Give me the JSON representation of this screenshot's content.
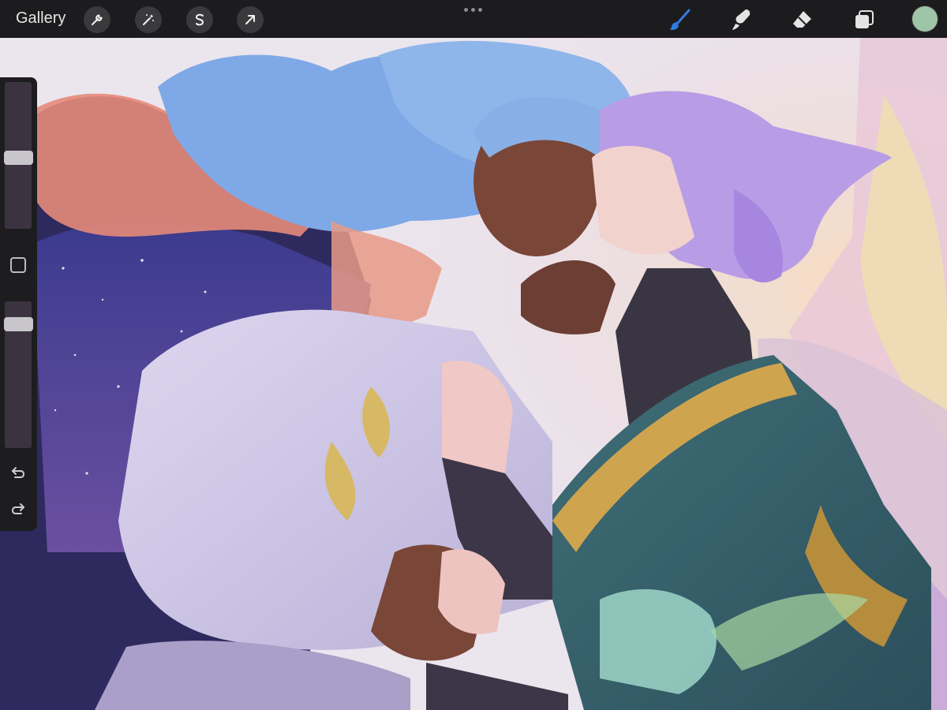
{
  "app": {
    "gallery_label": "Gallery",
    "more_menu_icon": "more-dots-icon"
  },
  "toolbar_left": [
    {
      "name": "actions",
      "icon": "wrench-icon"
    },
    {
      "name": "adjustments",
      "icon": "magic-wand-icon"
    },
    {
      "name": "selection",
      "icon": "selection-s-icon"
    },
    {
      "name": "transform",
      "icon": "arrow-cursor-icon"
    }
  ],
  "toolbar_right": [
    {
      "name": "brush",
      "icon": "brush-icon",
      "active": true
    },
    {
      "name": "smudge",
      "icon": "smudge-icon",
      "active": false
    },
    {
      "name": "eraser",
      "icon": "eraser-icon",
      "active": false
    },
    {
      "name": "layers",
      "icon": "layers-icon",
      "active": false
    }
  ],
  "colors": {
    "active_color": "#9fc5a8",
    "active_tool_accent": "#2f7ce0",
    "toolbar_bg": "#1c1b1d",
    "sidebar_bg": "#1d1c1f"
  },
  "sidebar": {
    "brush_size_level": 0.48,
    "opacity_level": 0.88,
    "undo_icon": "undo-icon",
    "redo_icon": "redo-icon",
    "modify_icon": "square-modify-icon"
  },
  "canvas": {
    "content": "artwork-two-figures-kissing"
  }
}
